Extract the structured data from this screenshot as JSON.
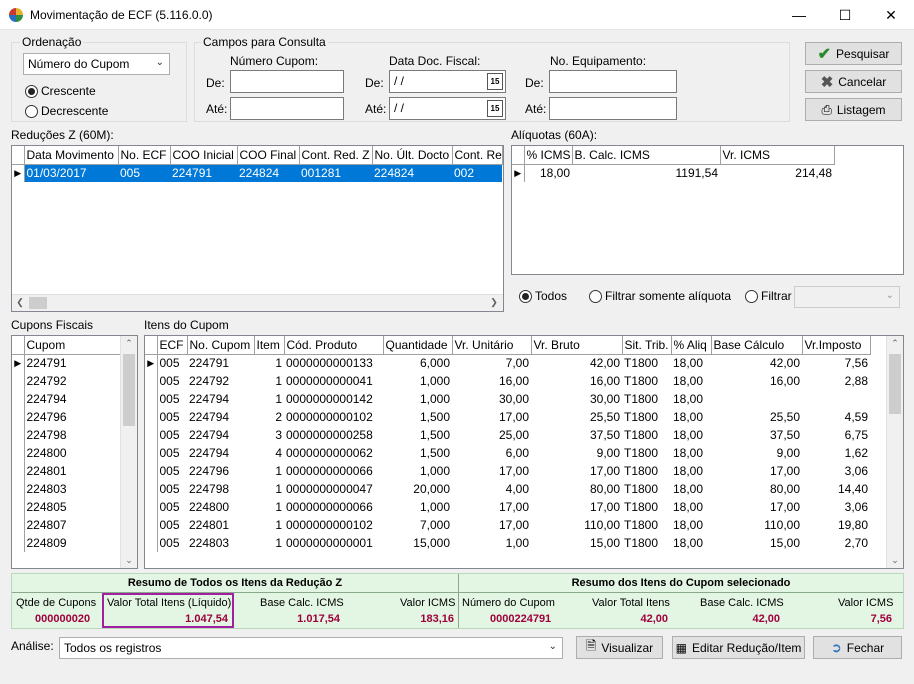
{
  "window": {
    "title": "Movimentação de ECF (5.116.0.0)"
  },
  "ordenacao": {
    "label": "Ordenação",
    "selected": "Número do Cupom",
    "opt_crescente": "Crescente",
    "opt_decrescente": "Decrescente"
  },
  "campos": {
    "label": "Campos para Consulta",
    "numero_cupom": "Número Cupom:",
    "data_doc": "Data Doc. Fiscal:",
    "no_equip": "No. Equipamento:",
    "de": "De:",
    "ate": "Até:",
    "date_value": " / /"
  },
  "buttons": {
    "pesquisar": "Pesquisar",
    "cancelar": "Cancelar",
    "listagem": "Listagem",
    "visualizar": "Visualizar",
    "editar": "Editar Redução/Item",
    "fechar": "Fechar"
  },
  "reducoes": {
    "label": "Reduções Z (60M):",
    "headers": [
      "Data Movimento",
      "No. ECF",
      "COO Inicial",
      "COO Final",
      "Cont. Red. Z",
      "No. Últ. Docto",
      "Cont. Re"
    ],
    "rows": [
      [
        "01/03/2017",
        "005",
        "224791",
        "224824",
        "001281",
        "224824",
        "002"
      ]
    ]
  },
  "aliquotas": {
    "label": "Alíquotas (60A):",
    "headers": [
      "% ICMS",
      "B. Calc. ICMS",
      "Vr. ICMS"
    ],
    "rows": [
      [
        "18,00",
        "1191,54",
        "214,48"
      ]
    ],
    "radio_todos": "Todos",
    "radio_filtrar_somente": "Filtrar somente alíquota",
    "radio_filtrar": "Filtrar"
  },
  "cupons": {
    "label": "Cupons Fiscais",
    "header": "Cupom",
    "rows": [
      "224791",
      "224792",
      "224794",
      "224796",
      "224798",
      "224800",
      "224801",
      "224803",
      "224805",
      "224807",
      "224809"
    ]
  },
  "itens": {
    "label": "Itens do Cupom",
    "headers": [
      "ECF",
      "No. Cupom",
      "Item",
      "Cód. Produto",
      "Quantidade",
      "Vr. Unitário",
      "Vr. Bruto",
      "Sit. Trib.",
      "% Aliq",
      "Base Cálculo",
      "Vr.Imposto"
    ],
    "rows": [
      [
        "005",
        "224791",
        "1",
        "0000000000133",
        "6,000",
        "7,00",
        "42,00",
        "T1800",
        "18,00",
        "42,00",
        "7,56"
      ],
      [
        "005",
        "224792",
        "1",
        "0000000000041",
        "1,000",
        "16,00",
        "16,00",
        "T1800",
        "18,00",
        "16,00",
        "2,88"
      ],
      [
        "005",
        "224794",
        "1",
        "0000000000142",
        "1,000",
        "30,00",
        "30,00",
        "T1800",
        "18,00",
        "",
        ""
      ],
      [
        "005",
        "224794",
        "2",
        "0000000000102",
        "1,500",
        "17,00",
        "25,50",
        "T1800",
        "18,00",
        "25,50",
        "4,59"
      ],
      [
        "005",
        "224794",
        "3",
        "0000000000258",
        "1,500",
        "25,00",
        "37,50",
        "T1800",
        "18,00",
        "37,50",
        "6,75"
      ],
      [
        "005",
        "224794",
        "4",
        "0000000000062",
        "1,500",
        "6,00",
        "9,00",
        "T1800",
        "18,00",
        "9,00",
        "1,62"
      ],
      [
        "005",
        "224796",
        "1",
        "0000000000066",
        "1,000",
        "17,00",
        "17,00",
        "T1800",
        "18,00",
        "17,00",
        "3,06"
      ],
      [
        "005",
        "224798",
        "1",
        "0000000000047",
        "20,000",
        "4,00",
        "80,00",
        "T1800",
        "18,00",
        "80,00",
        "14,40"
      ],
      [
        "005",
        "224800",
        "1",
        "0000000000066",
        "1,000",
        "17,00",
        "17,00",
        "T1800",
        "18,00",
        "17,00",
        "3,06"
      ],
      [
        "005",
        "224801",
        "1",
        "0000000000102",
        "7,000",
        "17,00",
        "110,00",
        "T1800",
        "18,00",
        "110,00",
        "19,80"
      ],
      [
        "005",
        "224803",
        "1",
        "0000000000001",
        "15,000",
        "1,00",
        "15,00",
        "T1800",
        "18,00",
        "15,00",
        "2,70"
      ]
    ]
  },
  "resumo": {
    "left_title": "Resumo de Todos os Itens da Redução Z",
    "right_title": "Resumo dos Itens do Cupom selecionado",
    "qtde_cupons_label": "Qtde de Cupons",
    "qtde_cupons_value": "000000020",
    "valor_total_liq_label": "Valor Total Itens (Líquido)",
    "valor_total_liq_value": "1.047,54",
    "base_calc_label": "Base Calc. ICMS",
    "base_calc_value": "1.017,54",
    "valor_icms_label": "Valor ICMS",
    "valor_icms_value": "183,16",
    "numero_cupom_label": "Número do Cupom",
    "numero_cupom_value": "0000224791",
    "valor_total_itens_label": "Valor Total Itens",
    "valor_total_itens_value": "42,00",
    "base_calc2_label": "Base Calc. ICMS",
    "base_calc2_value": "42,00",
    "valor_icms2_label": "Valor ICMS",
    "valor_icms2_value": "7,56"
  },
  "analise": {
    "label": "Análise:",
    "selected": "Todos os registros"
  },
  "colors": {
    "selection": "#0078d7",
    "summary_bg": "#e3f5e3",
    "summary_value": "#a0003c",
    "highlight_box": "#a020a0"
  }
}
